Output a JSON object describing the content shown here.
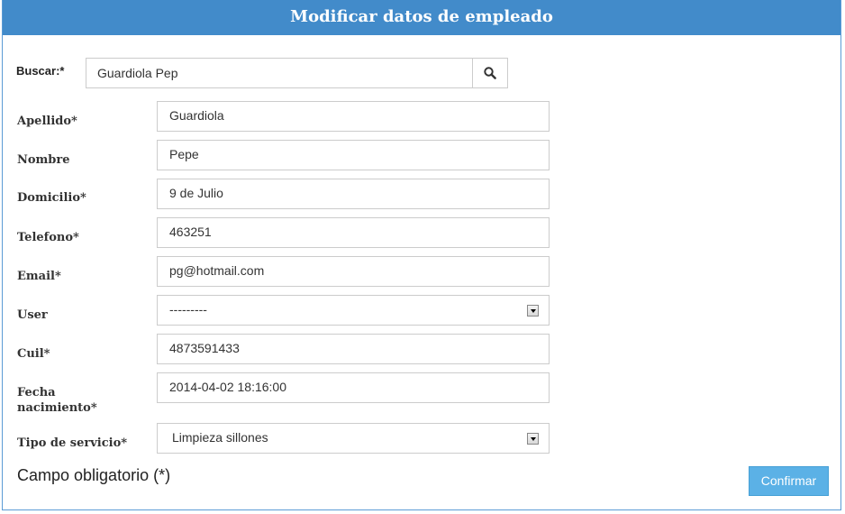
{
  "header": {
    "title": "Modificar datos de empleado"
  },
  "search": {
    "label": "Buscar:*",
    "value": "Guardiola Pep",
    "icon": "search-icon"
  },
  "fields": [
    {
      "label": "Apellido*",
      "value": "Guardiola",
      "type": "text"
    },
    {
      "label": "Nombre",
      "value": "Pepe",
      "type": "text"
    },
    {
      "label": "Domicilio*",
      "value": "9 de Julio",
      "type": "text"
    },
    {
      "label": "Telefono*",
      "value": "463251",
      "type": "text"
    },
    {
      "label": "Email*",
      "value": "pg@hotmail.com",
      "type": "text"
    },
    {
      "label": "User",
      "value": "---------",
      "type": "select"
    },
    {
      "label": "Cuil*",
      "value": "4873591433",
      "type": "text"
    },
    {
      "label_line1": "Fecha",
      "label_line2": "nacimiento*",
      "value": "2014-04-02 18:16:00",
      "type": "text"
    },
    {
      "label": "Tipo de servicio*",
      "value": "Limpieza sillones",
      "type": "select"
    }
  ],
  "footer": {
    "required_note": "Campo obligatorio (*)",
    "confirm_label": "Confirmar"
  },
  "colors": {
    "header": "#428bca",
    "confirm": "#5bb1e6"
  }
}
